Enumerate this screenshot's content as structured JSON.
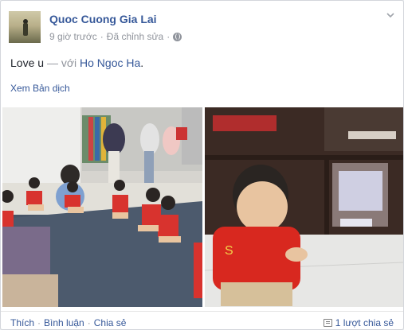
{
  "post": {
    "author": "Quoc Cuong Gia Lai",
    "time": "9 giờ trước",
    "separator": "·",
    "edited": "Đã chỉnh sửa",
    "status_text": "Love u",
    "with_text": "— với",
    "tagged": "Ho Ngoc Ha",
    "status_end": ".",
    "translate": "Xem Bản dịch"
  },
  "footer": {
    "like": "Thích",
    "comment": "Bình luận",
    "share": "Chia sẻ",
    "dot": "·",
    "shares_count": "1 lượt chia sẻ"
  },
  "colors": {
    "link": "#365899",
    "muted": "#90949c",
    "text": "#1d2129"
  },
  "icons": [
    "globe-icon",
    "chevron-down-icon",
    "share-count-icon"
  ]
}
